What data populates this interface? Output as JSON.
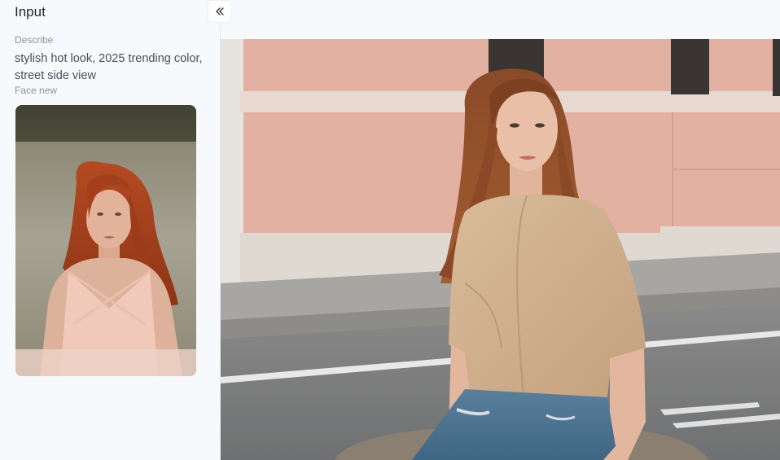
{
  "sidebar": {
    "title": "Input",
    "describe_label": "Describe",
    "describe_text": "stylish hot look, 2025 trending color, street side view",
    "face_label": "Face new",
    "collapse_icon": "double-chevron-left-icon"
  },
  "colors": {
    "background": "#f7f9fc",
    "title_text": "#1f2329",
    "label_text": "#8a919f",
    "body_text": "#4a4f58",
    "wall_pink": "#e3b1a1",
    "road_gray": "#7f8081"
  }
}
